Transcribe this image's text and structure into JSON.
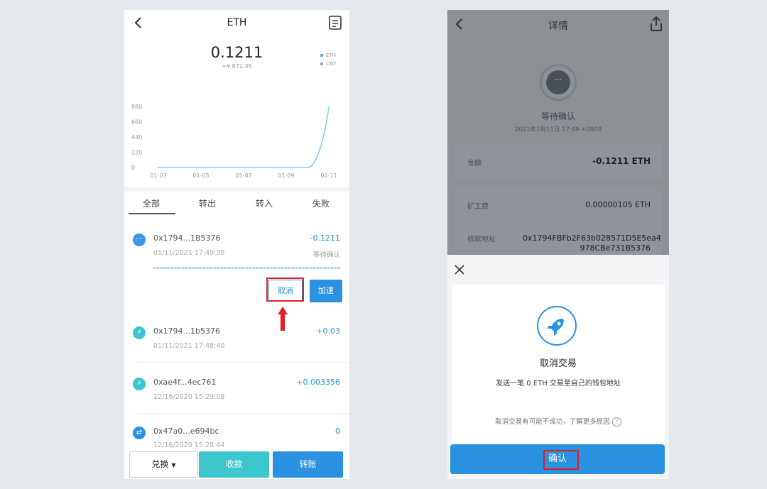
{
  "left": {
    "title": "ETH",
    "balance": "0.1211",
    "balance_fiat": "≈¥ 872.35",
    "legend": [
      {
        "label": "ETH",
        "color": "#5aaef0"
      },
      {
        "label": "CNY",
        "color": "#8fa9d6"
      }
    ],
    "tabs": [
      "全部",
      "转出",
      "转入",
      "失败"
    ],
    "transactions": [
      {
        "hash": "0x1794...1B5376",
        "time": "01/11/2021 17:49:38",
        "amount": "-0.1211",
        "status": "等待确认",
        "icon": "pending-icon",
        "icon_color": "#3a96e4"
      },
      {
        "hash": "0x1794...1b5376",
        "time": "01/11/2021 17:48:40",
        "amount": "+0.03",
        "status": "",
        "icon": "lightning-icon",
        "icon_color": "#3ec6cf"
      },
      {
        "hash": "0xae4f...4ec761",
        "time": "12/16/2020 15:29:08",
        "amount": "+0.003356",
        "status": "",
        "icon": "lightning-icon",
        "icon_color": "#3ec6cf"
      },
      {
        "hash": "0x47a0...e694bc",
        "time": "12/16/2020 15:28:44",
        "amount": "0",
        "status": "",
        "icon": "swap-icon",
        "icon_color": "#2a92e0"
      }
    ],
    "cancel_label": "取消",
    "speed_label": "加速",
    "bottom": {
      "swap": "兑换",
      "receive": "收款",
      "send": "转账"
    }
  },
  "chart_data": {
    "type": "line",
    "x": [
      "01-03",
      "01-05",
      "01-07",
      "01-09",
      "01-11"
    ],
    "xticks": [
      "01-03",
      "01-05",
      "01-07",
      "01-09",
      "01-11"
    ],
    "yticks": [
      "880",
      "660",
      "440",
      "220",
      "0"
    ],
    "ylim": [
      0,
      880
    ],
    "series": [
      {
        "points": [
          [
            "01-03",
            0
          ],
          [
            "01-04",
            0
          ],
          [
            "01-05",
            0
          ],
          [
            "01-06",
            0
          ],
          [
            "01-07",
            0
          ],
          [
            "01-08",
            0
          ],
          [
            "01-09",
            0
          ],
          [
            "01-10",
            0
          ],
          [
            "01-11",
            872.35
          ]
        ]
      }
    ],
    "line_color": "#8ccaf3"
  },
  "right": {
    "title": "详情",
    "status": "等待确认",
    "time": "2021年1月11日 17:49 +0800",
    "rows": [
      {
        "label": "金额",
        "value": "-0.1211 ETH"
      },
      {
        "label": "矿工费",
        "value": "0.00000105 ETH"
      },
      {
        "label": "收款地址",
        "value": "0x1794FBFb2F63b028571D5E5ea4 978CBe731B5376"
      }
    ],
    "sheet": {
      "title": "取消交易",
      "desc": "发送一笔 0 ETH 交易至自己的钱包地址",
      "note": "取消交易有可能不成功，了解更多原因",
      "confirm": "确认"
    }
  }
}
